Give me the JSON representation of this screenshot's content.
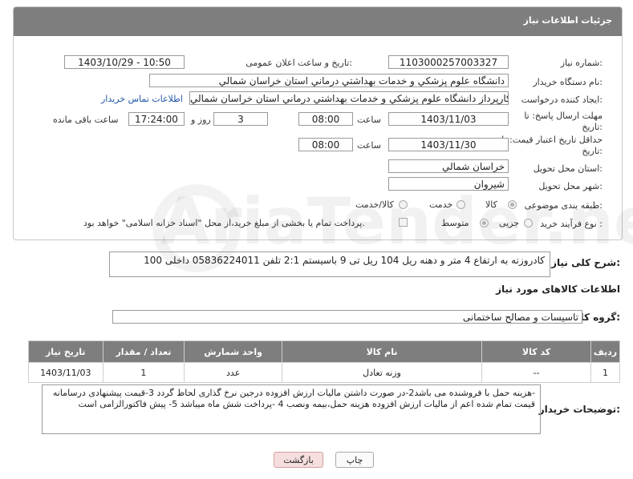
{
  "panel": {
    "title": "جزئیات اطلاعات نیاز"
  },
  "need_number": {
    "label": "شماره نیاز:",
    "value": "1103000257003327"
  },
  "announce_datetime": {
    "label": "تاریخ و ساعت اعلان عمومی:",
    "value": "1403/10/29 - 10:50"
  },
  "buyer_org": {
    "label": "نام دستگاه خریدار:",
    "value": "دانشگاه علوم پزشكي و خدمات بهداشتي درماني استان خراسان شمالي"
  },
  "requester": {
    "label": "ایجاد کننده درخواست:",
    "value": "غلامحسین گوهر کارپرداز  دانشگاه علوم پزشكي و خدمات بهداشتي درماني استان خراسان شمالي",
    "contact_link": "اطلاعات تماس خریدار"
  },
  "deadline": {
    "label_line1": "مهلت ارسال پاسخ: تا",
    "label_line2": "تاریخ:",
    "date": "1403/11/03",
    "time_label": "ساعت",
    "time": "08:00",
    "days": "3",
    "days_label": "روز و",
    "remaining_time": "17:24:00",
    "remaining_label": "ساعت باقی مانده"
  },
  "validity": {
    "label_line1": "حداقل تاریخ اعتبار قیمت: تا",
    "label_line2": "تاریخ:",
    "date": "1403/11/30",
    "time_label": "ساعت",
    "time": "08:00"
  },
  "delivery_province": {
    "label": "استان محل تحویل:",
    "value": "خراسان شمالي"
  },
  "delivery_city": {
    "label": "شهر محل تحویل:",
    "value": "شیروان"
  },
  "category": {
    "label": "طبقه بندی موضوعی:",
    "options": [
      "کالا",
      "خدمت",
      "کالا/خدمت"
    ],
    "selected": "کالا"
  },
  "purchase_type": {
    "label": "نوع فرآیند خرید :",
    "options": [
      "جزیی",
      "متوسط"
    ],
    "selected": "متوسط",
    "treasury_note": "پرداخت تمام یا بخشی از مبلغ خرید،از محل \"اسناد خزانه اسلامی\" خواهد بود."
  },
  "description": {
    "label": "شرح کلی نیاز:",
    "value": "کادروزنه به ارتفاع 4 متر و دهنه ریل 104 ریل تی 9 باسیستم 2:1    تلفن 05836224011 داخلی 100"
  },
  "goods_info_title": "اطلاعات کالاهای مورد نیاز",
  "goods_group": {
    "label": "گروه کالا:",
    "value": "تاسیسات و مصالح ساختمانی"
  },
  "table": {
    "headers": [
      "ردیف",
      "کد کالا",
      "نام کالا",
      "واحد شمارش",
      "تعداد / مقدار",
      "تاریخ نیاز"
    ],
    "rows": [
      [
        "1",
        "--",
        "وزنه تعادل",
        "عدد",
        "1",
        "1403/11/03"
      ]
    ]
  },
  "buyer_notes": {
    "label": "توضیحات خریدار:",
    "value": "-هزینه حمل با فروشنده می باشد2-در صورت داشتن مالیات ارزش افزوده درجین نرخ گذاری لحاظ گردد 3-قیمت پیشنهادی درسامانه  قیمت تمام شده اعم از مالیات ارزش افزوده هزینه حمل،بیمه ونصب 4 -پرداخت شش ماه میباشد 5-   پیش فاکتورالزامی است"
  },
  "buttons": {
    "print": "چاپ",
    "back": "بازگشت"
  },
  "watermark": "AriaTender.neT"
}
